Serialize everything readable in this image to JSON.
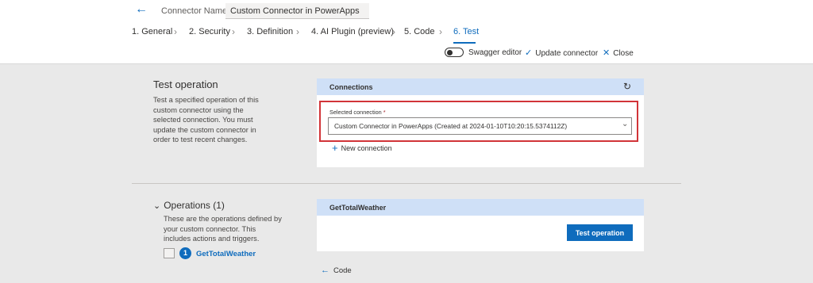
{
  "header": {
    "back_icon": "arrow-left-icon",
    "connector_name_label": "Connector Name",
    "connector_name_value": "Custom Connector in PowerApps"
  },
  "steps": [
    {
      "label": "1. General",
      "active": false
    },
    {
      "label": "2. Security",
      "active": false
    },
    {
      "label": "3. Definition",
      "active": false
    },
    {
      "label": "4. AI Plugin (preview)",
      "active": false
    },
    {
      "label": "5. Code",
      "active": false
    },
    {
      "label": "6. Test",
      "active": true
    }
  ],
  "toolbar": {
    "swagger_label": "Swagger editor",
    "swagger_on": false,
    "update_label": "Update connector",
    "close_label": "Close"
  },
  "test_section": {
    "title": "Test operation",
    "description": "Test a specified operation of this custom connector using the selected connection. You must update the custom connector in order to test recent changes."
  },
  "connections": {
    "title": "Connections",
    "selected_label": "Selected connection",
    "required_mark": "*",
    "selected_value": "Custom Connector in PowerApps (Created at 2024-01-10T10:20:15.5374112Z)",
    "new_connection_label": "New connection"
  },
  "operations": {
    "title": "Operations (1)",
    "description": "These are the operations defined by your custom connector. This includes actions and triggers.",
    "items": [
      {
        "number": "1",
        "name": "GetTotalWeather"
      }
    ]
  },
  "operation_card": {
    "title": "GetTotalWeather",
    "test_button_label": "Test operation"
  },
  "footer": {
    "code_link_label": "Code"
  },
  "colors": {
    "accent": "#0f6cbd",
    "highlight_border": "#d13438",
    "card_header": "#cfe0f7",
    "page_background": "#e9e9e9"
  }
}
